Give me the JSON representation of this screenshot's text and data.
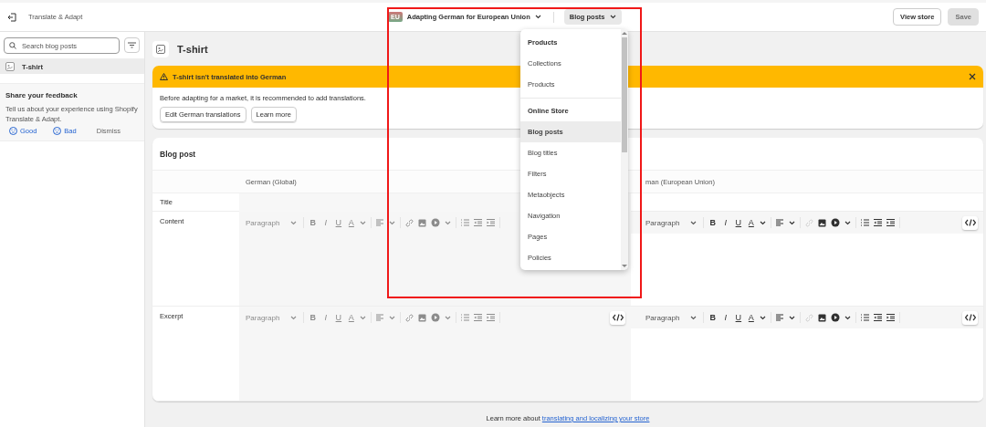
{
  "app_bar": {
    "title": "Translate & Adapt",
    "market": {
      "badge": "EU",
      "label": "Adapting German for European Union"
    },
    "resource_picker": {
      "label": "Blog posts",
      "expanded": true
    },
    "buttons": [
      {
        "label": "View store",
        "disabled": false
      },
      {
        "label": "Save",
        "disabled": true
      }
    ]
  },
  "sidebar": {
    "search": {
      "placeholder": "Search blog posts"
    },
    "items": [
      {
        "label": "T-shirt",
        "selected": true
      }
    ],
    "feedback": {
      "title": "Share your feedback",
      "text": "Tell us about your experience using Shopify Translate & Adapt.",
      "actions": [
        {
          "label": "Good",
          "kind": "good"
        },
        {
          "label": "Bad",
          "kind": "bad"
        },
        {
          "label": "Dismiss",
          "kind": "plain"
        }
      ]
    }
  },
  "page": {
    "title": "T-shirt"
  },
  "banner": {
    "title": "T-shirt isn't translated into German",
    "text": "Before adapting for a market, it is recommended to add translations.",
    "buttons": [
      "Edit German translations",
      "Learn more"
    ]
  },
  "blog_post": {
    "title": "Blog post",
    "columns": [
      "German (Global)",
      "man (European Union)"
    ],
    "fields": [
      {
        "label": "Title",
        "kind": "line"
      },
      {
        "label": "Content",
        "kind": "rich",
        "editors": [
          {
            "style": "Paragraph",
            "tools": [
              "B",
              "I",
              "U",
              "A"
            ],
            "disabled": true,
            "code_button": false
          },
          {
            "style": "Paragraph",
            "tools": [
              "B",
              "I",
              "U",
              "A"
            ],
            "disabled": false,
            "code_button": true
          }
        ]
      },
      {
        "label": "Excerpt",
        "kind": "rich",
        "editors": [
          {
            "style": "Paragraph",
            "tools": [
              "B",
              "I",
              "U",
              "A"
            ],
            "disabled": true,
            "code_button": true
          },
          {
            "style": "Paragraph",
            "tools": [
              "B",
              "I",
              "U",
              "A"
            ],
            "disabled": false,
            "code_button": true
          }
        ]
      }
    ]
  },
  "dropdown": {
    "items": [
      {
        "label": "Products",
        "kind": "header"
      },
      {
        "label": "Collections",
        "kind": "item",
        "selected": false
      },
      {
        "label": "Products",
        "kind": "item",
        "selected": false
      },
      {
        "label": "Online Store",
        "kind": "header"
      },
      {
        "label": "Blog posts",
        "kind": "item",
        "selected": true
      },
      {
        "label": "Blog titles",
        "kind": "item",
        "selected": false
      },
      {
        "label": "Filters",
        "kind": "item",
        "selected": false
      },
      {
        "label": "Metaobjects",
        "kind": "item",
        "selected": false
      },
      {
        "label": "Navigation",
        "kind": "item",
        "selected": false
      },
      {
        "label": "Pages",
        "kind": "item",
        "selected": false
      },
      {
        "label": "Policies",
        "kind": "item",
        "selected": false
      }
    ]
  },
  "footer": {
    "text": "Learn more about",
    "link": "translating and localizing your store"
  }
}
